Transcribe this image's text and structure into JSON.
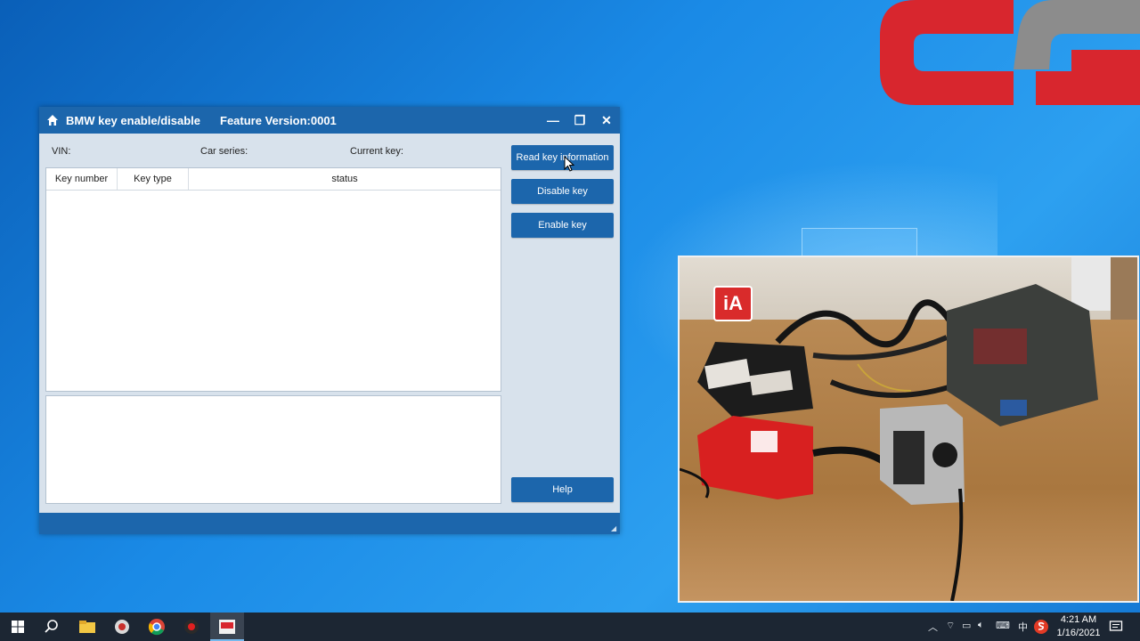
{
  "window": {
    "title": "BMW key enable/disable",
    "version": "Feature Version:0001",
    "minimize_glyph": "—",
    "maximize_glyph": "❐",
    "close_glyph": "✕"
  },
  "info": {
    "vin_label": "VIN:",
    "series_label": "Car series:",
    "current_key_label": "Current key:"
  },
  "table": {
    "columns": [
      "Key number",
      "Key type",
      "status"
    ],
    "rows": []
  },
  "actions": {
    "read": "Read key information",
    "disable": "Disable key",
    "enable": "Enable key",
    "help": "Help"
  },
  "overlay": {
    "badge": "iA"
  },
  "taskbar": {
    "tray_ime": "中",
    "time": "4:21 AM",
    "date": "1/16/2021"
  },
  "colors": {
    "accent": "#1c66ac",
    "logo_red": "#d8262e",
    "logo_gray": "#8c8c8c"
  }
}
